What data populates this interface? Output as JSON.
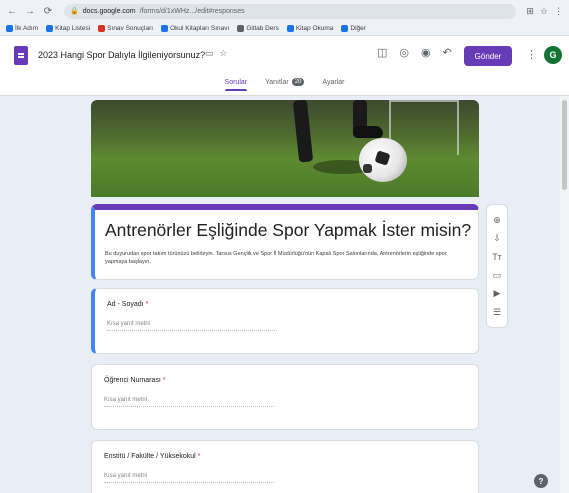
{
  "browser": {
    "back": "←",
    "forward": "→",
    "reload": "⟳",
    "url_host": "docs.google.com",
    "url_path": "/forms/d/1xWHz.../edit#responses",
    "icons": [
      "⊞",
      "☆",
      "⋮"
    ],
    "bookmarks": [
      {
        "label": "İlk Adım",
        "icon": "blue"
      },
      {
        "label": "Kitap Listesi",
        "icon": "blue"
      },
      {
        "label": "Sınav Sonuçları",
        "icon": "red"
      },
      {
        "label": "Okul Kitapları Sınavı",
        "icon": "blue"
      },
      {
        "label": "Gitlab Ders",
        "icon": "grey"
      },
      {
        "label": "Kitap Okuma",
        "icon": "blue"
      },
      {
        "label": "Diğer",
        "icon": "blue"
      }
    ]
  },
  "forms_header": {
    "doc_title": "2023 Hangi Spor Dalıyla İlgileniyorsunuz?",
    "folder_icon": "folder-icon",
    "star_icon": "star-icon",
    "actions": [
      "◫",
      "◎",
      "◉",
      "↶",
      "↷"
    ],
    "send_label": "Gönder",
    "more": "⋮",
    "avatar_letter": "G",
    "tabs": [
      {
        "label": "Sorular",
        "active": true
      },
      {
        "label": "Yanıtlar",
        "badge": "20"
      },
      {
        "label": "Ayarlar"
      }
    ]
  },
  "form": {
    "title": "Antrenörler Eşliğinde Spor Yapmak İster misin?",
    "description": "Bu duyurudan spor takım türünüzü belirleyin. Tarsus Gençlik ve Spor İl Müdürlüğü'nün Kapalı Spor Salonlarında, Antrenörlerin eşliğinde spor yapmaya başlayın.",
    "questions": [
      {
        "title": "Ad - Soyadı",
        "required": "*",
        "placeholder": "Kısa yanıt metni"
      },
      {
        "title": "Öğrenci Numarası",
        "required": "*",
        "placeholder": "Kısa yanıt metni"
      },
      {
        "title": "Enstitü / Fakülte / Yüksekokul",
        "required": "*",
        "placeholder": "Kısa yanıt metni"
      }
    ]
  },
  "toolbar": {
    "tools": [
      "⊕",
      "⇩",
      "Tт",
      "▭",
      "▶",
      "☰"
    ]
  },
  "help": "?"
}
